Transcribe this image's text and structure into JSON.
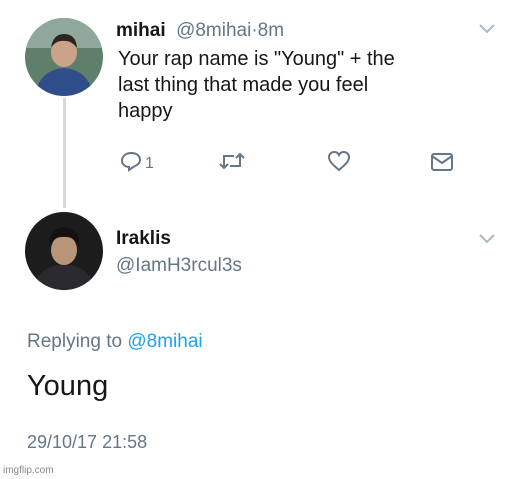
{
  "tweet1": {
    "name": "mihai",
    "handle": "@8mihai",
    "separator": "·",
    "time": "8m",
    "text_line1": "Your rap name is \"Young\" + the",
    "text_line2": "last thing that made you feel",
    "text_line3": "happy",
    "reply_count": "1",
    "icons": [
      "avatar",
      "chevron-down-icon",
      "reply-icon",
      "retweet-icon",
      "like-icon",
      "message-icon"
    ]
  },
  "tweet2": {
    "name": "Iraklis",
    "handle": "@IamH3rcul3s",
    "replying_prefix": "Replying to",
    "replying_handle": "@8mihai",
    "text": "Young",
    "timestamp": "29/10/17 21:58"
  },
  "watermark": "imgflip.com",
  "colors": {
    "text": "#14171a",
    "secondary": "#657786",
    "link": "#1da1f2",
    "thread_line": "#d6d9dc"
  }
}
